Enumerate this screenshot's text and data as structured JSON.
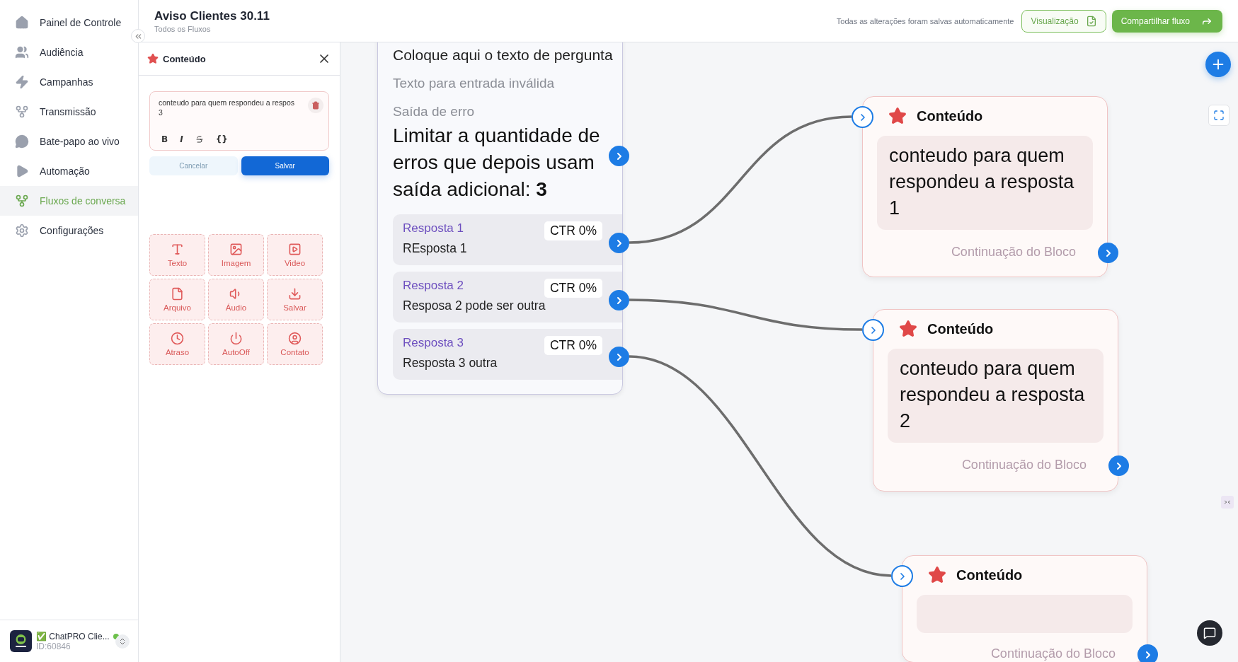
{
  "sidebar": {
    "items": [
      {
        "label": "Painel de Controle",
        "selected": false
      },
      {
        "label": "Audiência",
        "selected": false
      },
      {
        "label": "Campanhas",
        "selected": false
      },
      {
        "label": "Transmissão",
        "selected": false
      },
      {
        "label": "Bate-papo ao vivo",
        "selected": false
      },
      {
        "label": "Automação",
        "selected": false
      },
      {
        "label": "Fluxos de conversa",
        "selected": true
      },
      {
        "label": "Configurações",
        "selected": false
      }
    ],
    "account": {
      "name": "✅ ChatPRO Clie...",
      "id": "ID:60846",
      "online": true
    }
  },
  "header": {
    "title": "Aviso Clientes 30.11",
    "breadcrumb": "Todos os Fluxos",
    "save_status": "Todas as alterações foram salvas automaticamente",
    "preview_button": "Visualização",
    "share_button": "Compartilhar fluxo"
  },
  "content_panel": {
    "title": "Conteúdo",
    "message_lines": [
      "conteudo para quem respondeu a respos",
      "3"
    ],
    "format_buttons": [
      {
        "kind": "bold",
        "label": "B"
      },
      {
        "kind": "italic",
        "label": "I"
      },
      {
        "kind": "strike"
      },
      {
        "kind": "code",
        "label": "{}"
      }
    ],
    "cancel_button": {
      "label": "Cancelar",
      "disabled": true
    },
    "save_button": {
      "label": "Salvar",
      "disabled": false
    },
    "blocks": [
      {
        "label": "Texto"
      },
      {
        "label": "Imagem"
      },
      {
        "label": "Video"
      },
      {
        "label": "Arquivo"
      },
      {
        "label": "Áudio"
      },
      {
        "label": "Salvar"
      },
      {
        "label": "Atraso"
      },
      {
        "label": "AutoOff"
      },
      {
        "label": "Contato"
      }
    ]
  },
  "canvas": {
    "question_node": {
      "question": "Coloque aqui o texto de pergunta",
      "invalid_input_text": "Texto para entrada inválida",
      "error_label": "Saída de erro",
      "error_limit": "Limitar a quantidade de erros que depois usam saída adicional: **3**",
      "answers": [
        {
          "title": "Resposta 1",
          "ctr": "CTR 0%",
          "text": "REsposta 1"
        },
        {
          "title": "Resposta 2",
          "ctr": "CTR 0%",
          "text": "Resposa 2 pode ser outra"
        },
        {
          "title": "Resposta 3",
          "ctr": "CTR 0%",
          "text": "Resposta 3 outra"
        }
      ]
    },
    "content_nodes": [
      {
        "title": "Conteúdo",
        "message": "conteudo para quem respondeu a resposta 1",
        "continuation": "Continuação do Bloco"
      },
      {
        "title": "Conteúdo",
        "message": "conteudo para quem respondeu a resposta 2",
        "continuation": "Continuação do Bloco"
      },
      {
        "title": "Conteúdo",
        "continuation": "Continuação do Bloco"
      }
    ]
  }
}
